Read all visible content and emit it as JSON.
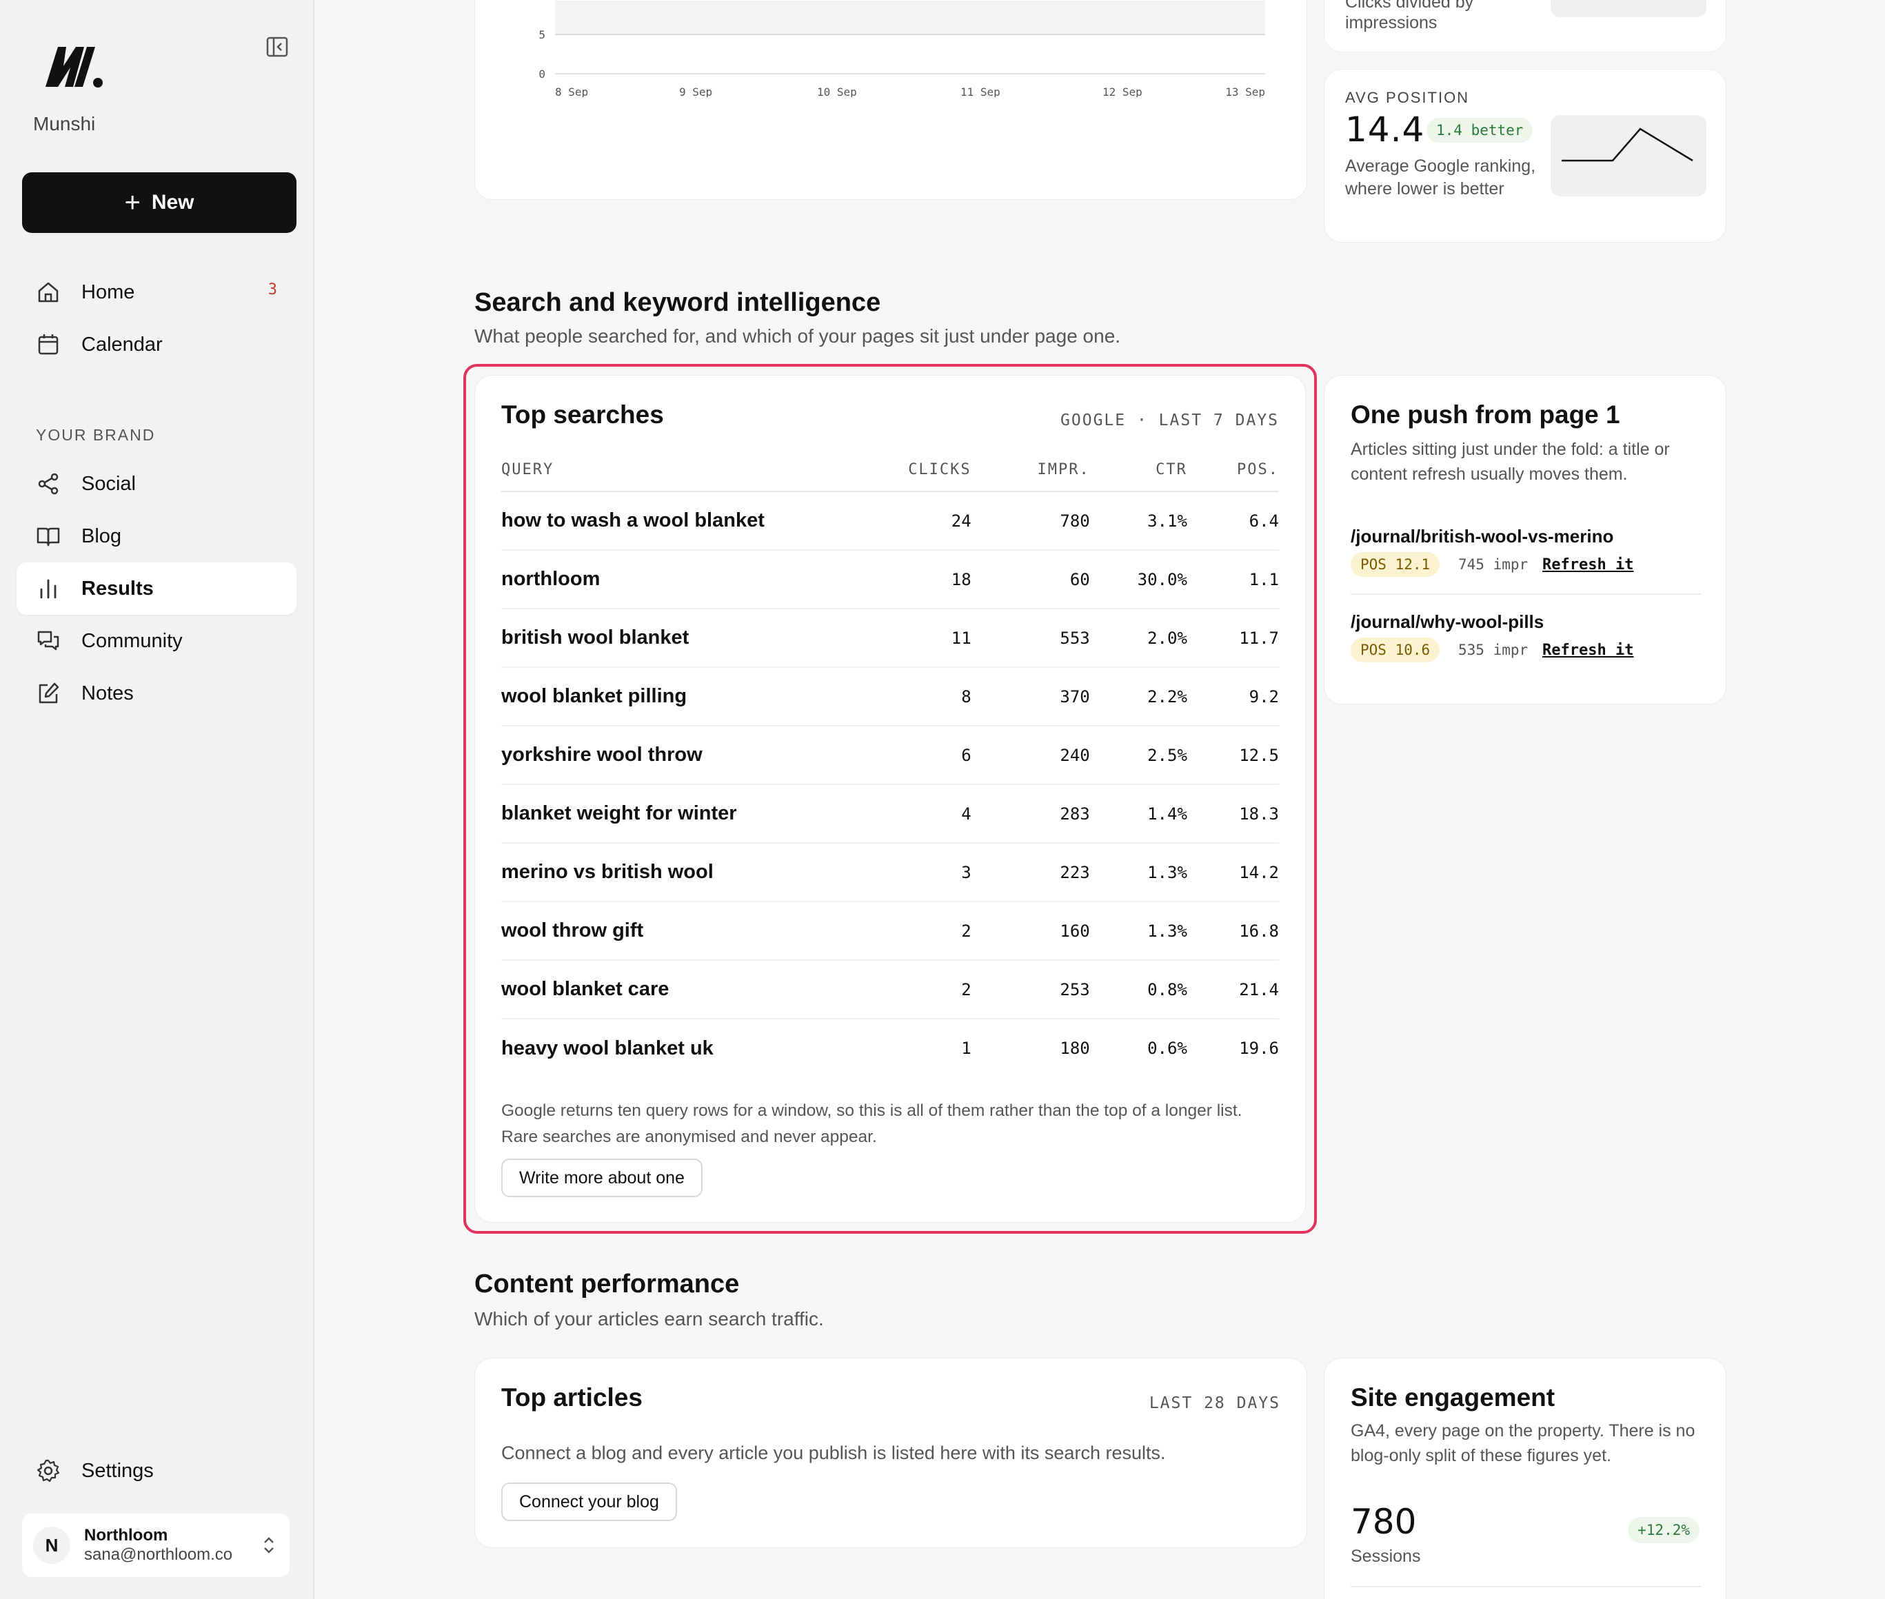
{
  "sidebar": {
    "brand_name": "Munshi",
    "new_button": "New",
    "nav": [
      {
        "label": "Home",
        "badge": "3"
      },
      {
        "label": "Calendar"
      }
    ],
    "section_label": "YOUR BRAND",
    "brand_nav": [
      {
        "label": "Social"
      },
      {
        "label": "Blog"
      },
      {
        "label": "Results",
        "active": true
      },
      {
        "label": "Community"
      },
      {
        "label": "Notes"
      }
    ],
    "settings": "Settings",
    "account": {
      "initial": "N",
      "name": "Northloom",
      "email": "sana@northloom.co"
    }
  },
  "clicks_chart": {
    "y_ticks": [
      "5",
      "0"
    ],
    "x_ticks": [
      "8 Sep",
      "9 Sep",
      "10 Sep",
      "11 Sep",
      "12 Sep",
      "13 Sep"
    ]
  },
  "ctr_card": {
    "desc_line1": "Clicks divided by",
    "desc_line2": "impressions"
  },
  "avg_position": {
    "label": "AVG POSITION",
    "value": "14.4",
    "change": "1.4 better",
    "desc": "Average Google ranking, where lower is better"
  },
  "search_section": {
    "title": "Search and keyword intelligence",
    "subtitle": "What people searched for, and which of your pages sit just under page one."
  },
  "top_searches": {
    "title": "Top searches",
    "meta": "GOOGLE · LAST 7 DAYS",
    "columns": [
      "QUERY",
      "CLICKS",
      "IMPR.",
      "CTR",
      "POS."
    ],
    "rows": [
      [
        "how to wash a wool blanket",
        "24",
        "780",
        "3.1%",
        "6.4"
      ],
      [
        "northloom",
        "18",
        "60",
        "30.0%",
        "1.1"
      ],
      [
        "british wool blanket",
        "11",
        "553",
        "2.0%",
        "11.7"
      ],
      [
        "wool blanket pilling",
        "8",
        "370",
        "2.2%",
        "9.2"
      ],
      [
        "yorkshire wool throw",
        "6",
        "240",
        "2.5%",
        "12.5"
      ],
      [
        "blanket weight for winter",
        "4",
        "283",
        "1.4%",
        "18.3"
      ],
      [
        "merino vs british wool",
        "3",
        "223",
        "1.3%",
        "14.2"
      ],
      [
        "wool throw gift",
        "2",
        "160",
        "1.3%",
        "16.8"
      ],
      [
        "wool blanket care",
        "2",
        "253",
        "0.8%",
        "21.4"
      ],
      [
        "heavy wool blanket uk",
        "1",
        "180",
        "0.6%",
        "19.6"
      ]
    ],
    "note": "Google returns ten query rows for a window, so this is all of them rather than the top of a longer list. Rare searches are anonymised and never appear.",
    "button": "Write more about one"
  },
  "one_push": {
    "title": "One push from page 1",
    "desc": "Articles sitting just under the fold: a title or content refresh usually moves them.",
    "items": [
      {
        "url": "/journal/british-wool-vs-merino",
        "pos": "POS 12.1",
        "impr": "745 impr",
        "action": "Refresh it"
      },
      {
        "url": "/journal/why-wool-pills",
        "pos": "POS 10.6",
        "impr": "535 impr",
        "action": "Refresh it"
      }
    ]
  },
  "content_section": {
    "title": "Content performance",
    "subtitle": "Which of your articles earn search traffic."
  },
  "top_articles": {
    "title": "Top articles",
    "meta": "LAST 28 DAYS",
    "desc": "Connect a blog and every article you publish is listed here with its search results.",
    "button": "Connect your blog"
  },
  "site_engagement": {
    "title": "Site engagement",
    "desc": "GA4, every page on the property. There is no blog-only split of these figures yet.",
    "value": "780",
    "label": "Sessions",
    "change": "+12.2%"
  },
  "colors": {
    "accent_highlight": "#e0335e",
    "primary_button": "#111111",
    "badge": "#c0392b",
    "positive": "#2d7a3a"
  }
}
